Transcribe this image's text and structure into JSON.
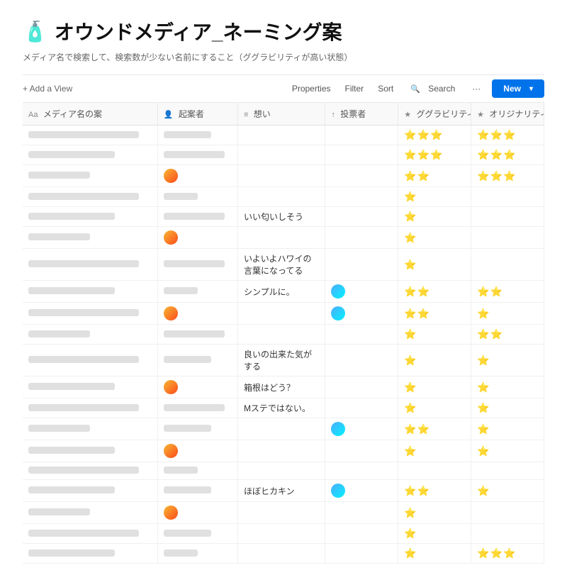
{
  "page": {
    "icon": "🧴",
    "title": "オウンドメディア_ネーミング案",
    "subtitle": "メディア名で検索して、検索数が少ない名前にすること（ググラビリティが高い状態）"
  },
  "toolbar": {
    "add_view_label": "+ Add a View",
    "properties_label": "Properties",
    "filter_label": "Filter",
    "sort_label": "Sort",
    "search_label": "Search",
    "more_label": "···",
    "new_label": "New"
  },
  "table": {
    "columns": [
      {
        "id": "name",
        "icon": "Aa",
        "label": "メディア名の案"
      },
      {
        "id": "starter",
        "icon": "👤",
        "label": "起案者"
      },
      {
        "id": "thought",
        "icon": "≡",
        "label": "想い"
      },
      {
        "id": "voter",
        "icon": "↑",
        "label": "投票者"
      },
      {
        "id": "gg",
        "icon": "★",
        "label": "ググラビリティ"
      },
      {
        "id": "orig",
        "icon": "★",
        "label": "オリジナリティ"
      }
    ],
    "rows": [
      {
        "name_blur": "lg",
        "starter_blur": "md",
        "thought": "",
        "voter_blur": false,
        "gg": "⭐⭐⭐",
        "orig": "⭐⭐⭐"
      },
      {
        "name_blur": "md",
        "starter_blur": "lg",
        "thought": "",
        "voter_blur": false,
        "gg": "⭐⭐⭐",
        "orig": "⭐⭐⭐"
      },
      {
        "name_blur": "sm",
        "starter_blur": "md",
        "thought": "",
        "voter_blur": false,
        "gg": "⭐⭐",
        "orig": "⭐⭐⭐"
      },
      {
        "name_blur": "lg",
        "starter_blur": "sm",
        "thought": "",
        "voter_blur": false,
        "gg": "⭐",
        "orig": ""
      },
      {
        "name_blur": "md",
        "starter_blur": "lg",
        "thought": "いい匂いしそう",
        "voter_blur": false,
        "gg": "⭐",
        "orig": ""
      },
      {
        "name_blur": "sm",
        "starter_blur": "md",
        "thought": "",
        "voter_blur": false,
        "gg": "⭐",
        "orig": ""
      },
      {
        "name_blur": "lg",
        "starter_blur": "lg",
        "thought": "いよいよハワイの言葉になってる",
        "voter_blur": false,
        "gg": "⭐",
        "orig": ""
      },
      {
        "name_blur": "md",
        "starter_blur": "sm",
        "thought": "シンプルに。",
        "voter_blur": true,
        "gg": "⭐⭐",
        "orig": "⭐⭐"
      },
      {
        "name_blur": "lg",
        "starter_blur": "md",
        "thought": "",
        "voter_blur": true,
        "gg": "⭐⭐",
        "orig": "⭐"
      },
      {
        "name_blur": "sm",
        "starter_blur": "lg",
        "thought": "",
        "voter_blur": false,
        "gg": "⭐",
        "orig": "⭐⭐"
      },
      {
        "name_blur": "lg",
        "starter_blur": "md",
        "thought": "良いの出来た気がする",
        "voter_blur": false,
        "gg": "⭐",
        "orig": "⭐"
      },
      {
        "name_blur": "md",
        "starter_blur": "sm",
        "thought": "箱根はどう？",
        "voter_blur": false,
        "gg": "⭐",
        "orig": "⭐"
      },
      {
        "name_blur": "lg",
        "starter_blur": "lg",
        "thought": "Mステではない。",
        "voter_blur": false,
        "gg": "⭐",
        "orig": "⭐"
      },
      {
        "name_blur": "sm",
        "starter_blur": "md",
        "thought": "",
        "voter_blur": true,
        "gg": "⭐⭐",
        "orig": "⭐"
      },
      {
        "name_blur": "md",
        "starter_blur": "lg",
        "thought": "",
        "voter_blur": false,
        "gg": "⭐",
        "orig": "⭐"
      },
      {
        "name_blur": "lg",
        "starter_blur": "sm",
        "thought": "",
        "voter_blur": false,
        "gg": "",
        "orig": ""
      },
      {
        "name_blur": "md",
        "starter_blur": "md",
        "thought": "ほぼヒカキン",
        "voter_blur": true,
        "gg": "⭐⭐",
        "orig": "⭐"
      },
      {
        "name_blur": "sm",
        "starter_blur": "lg",
        "thought": "",
        "voter_blur": false,
        "gg": "⭐",
        "orig": ""
      },
      {
        "name_blur": "lg",
        "starter_blur": "md",
        "thought": "",
        "voter_blur": false,
        "gg": "⭐",
        "orig": ""
      },
      {
        "name_blur": "md",
        "starter_blur": "sm",
        "thought": "",
        "voter_blur": false,
        "gg": "⭐",
        "orig": "⭐⭐⭐"
      }
    ]
  },
  "colors": {
    "accent": "#0073ea",
    "star": "#f7b731"
  }
}
